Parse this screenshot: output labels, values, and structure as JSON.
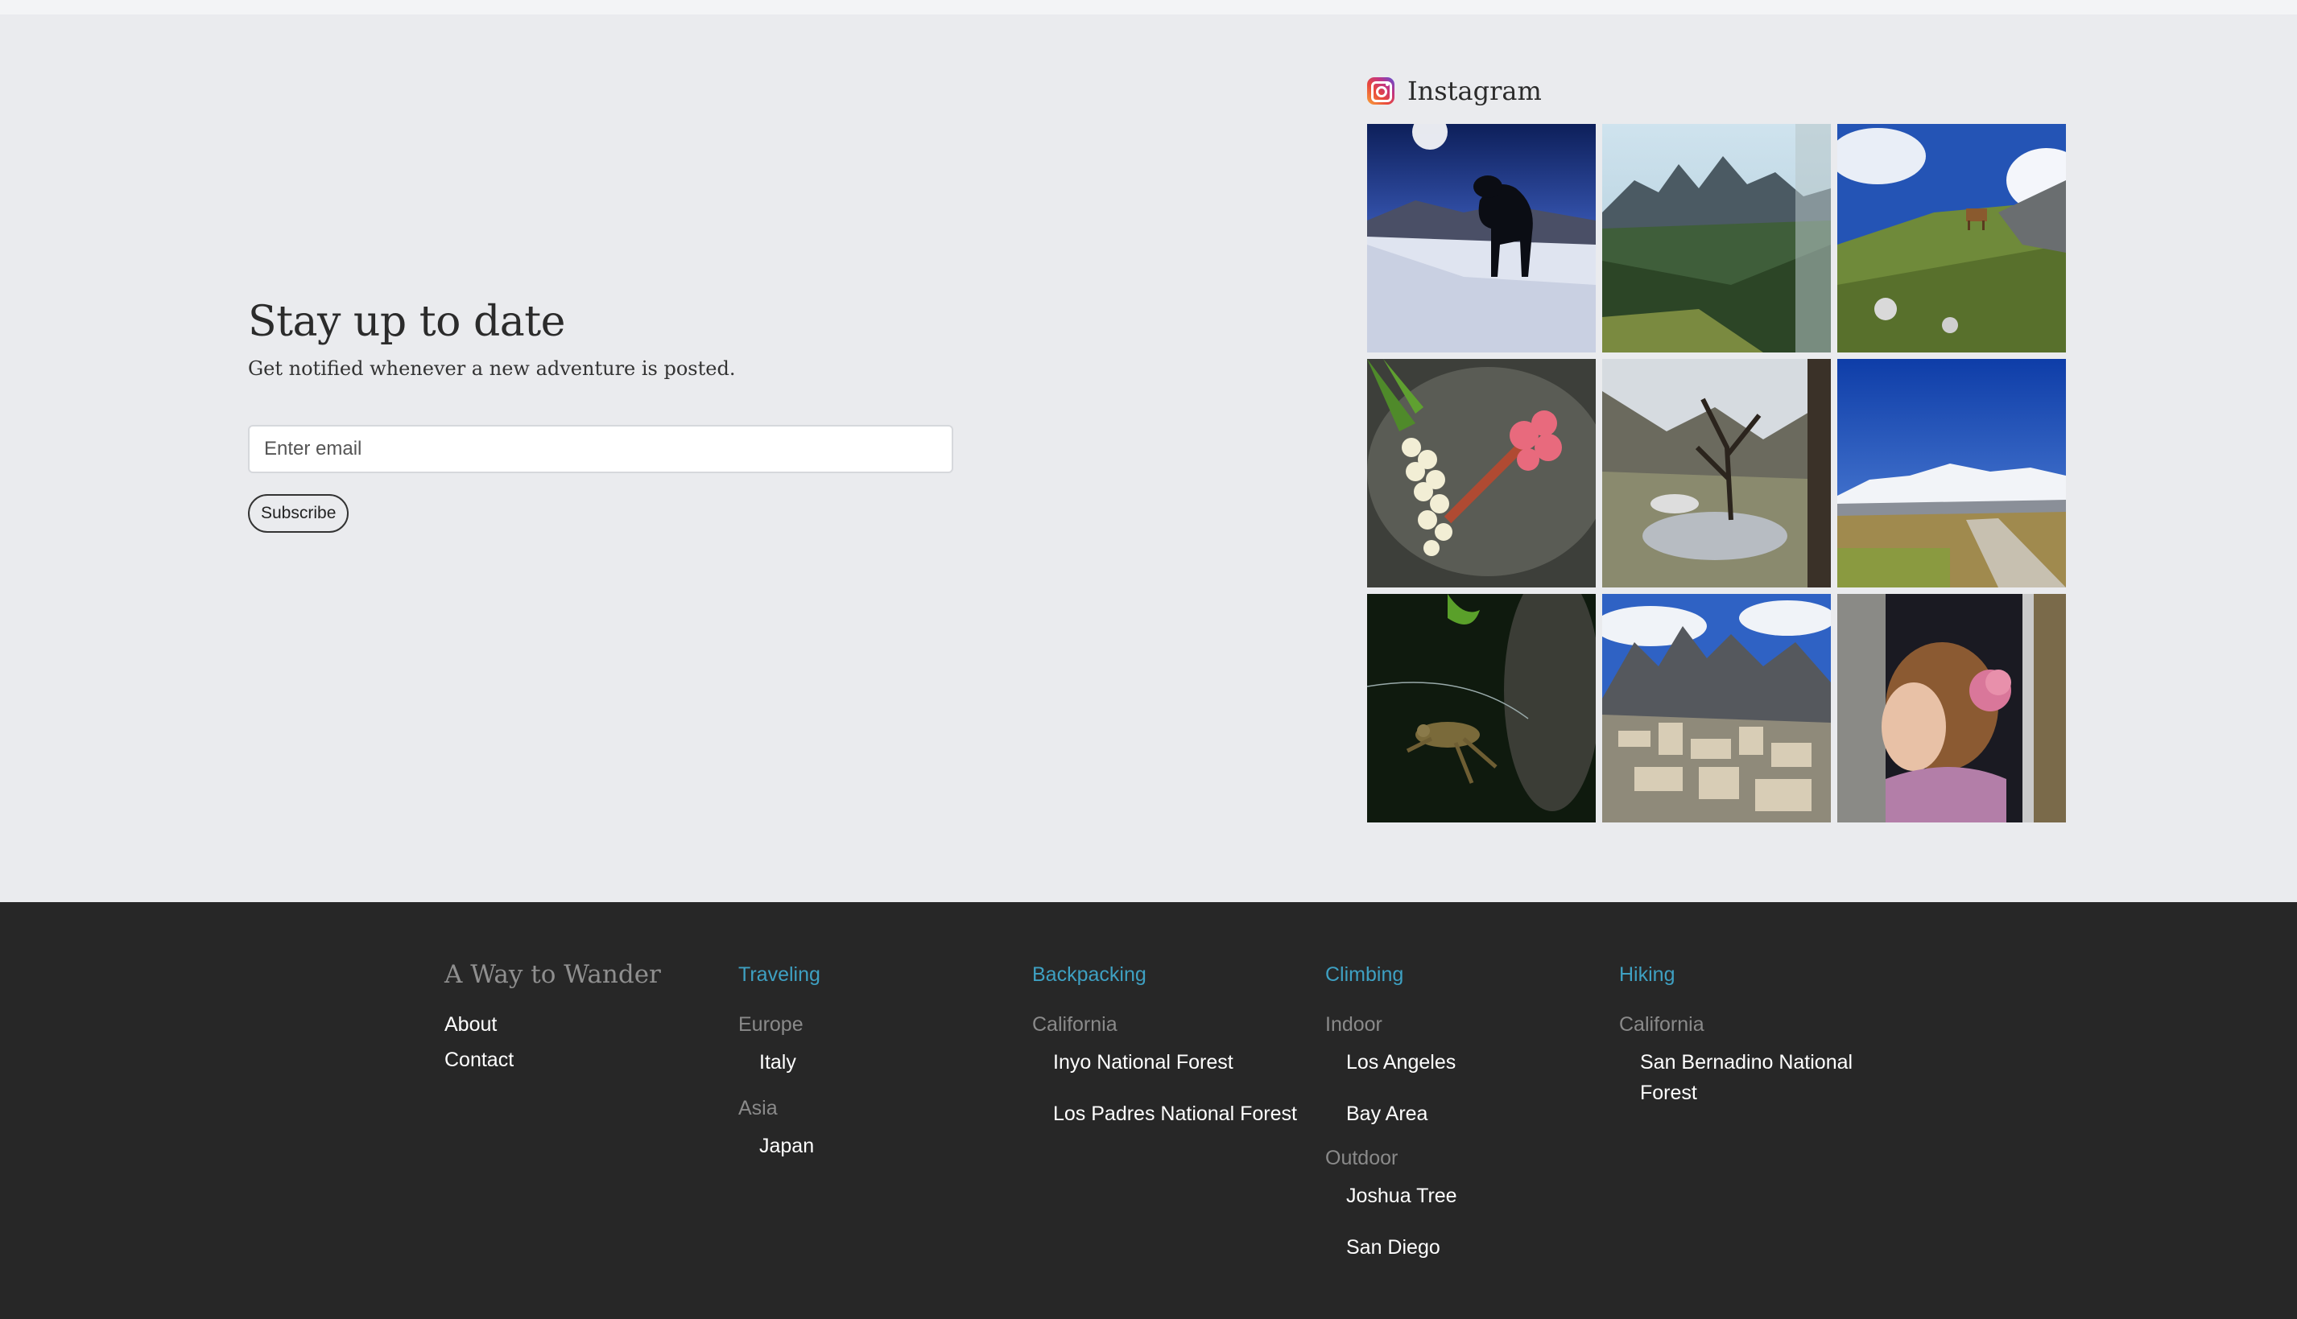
{
  "subscribe": {
    "title": "Stay up to date",
    "description": "Get notified whenever a new adventure is posted.",
    "email_placeholder": "Enter email",
    "button_label": "Subscribe"
  },
  "instagram": {
    "label": "Instagram",
    "photos": [
      "dog-snow-photo",
      "mountain-valley-photo",
      "cow-hillside-photo",
      "flower-rock-photo",
      "stream-tree-photo",
      "snowy-mountains-road-photo",
      "frog-water-photo",
      "rock-cairns-photo",
      "girl-flower-hair-photo"
    ]
  },
  "footer": {
    "brand": "A Way to Wander",
    "links": [
      "About",
      "Contact"
    ],
    "traveling": {
      "heading": "Traveling",
      "groups": [
        {
          "name": "Europe",
          "items": [
            "Italy"
          ]
        },
        {
          "name": "Asia",
          "items": [
            "Japan"
          ]
        }
      ]
    },
    "backpacking": {
      "heading": "Backpacking",
      "groups": [
        {
          "name": "California",
          "items": [
            "Inyo National Forest",
            "Los Padres National Forest"
          ]
        }
      ]
    },
    "climbing": {
      "heading": "Climbing",
      "groups": [
        {
          "name": "Indoor",
          "items": [
            "Los Angeles",
            "Bay Area"
          ]
        },
        {
          "name": "Outdoor",
          "items": [
            "Joshua Tree",
            "San Diego"
          ]
        }
      ]
    },
    "hiking": {
      "heading": "Hiking",
      "groups": [
        {
          "name": "California",
          "items": [
            "San Bernadino National Forest"
          ]
        }
      ]
    }
  },
  "colors": {
    "page_bg": "#eaebee",
    "footer_bg": "#272727",
    "footer_heading": "#3ea0c2",
    "footer_subheading": "#8a8a8a"
  }
}
